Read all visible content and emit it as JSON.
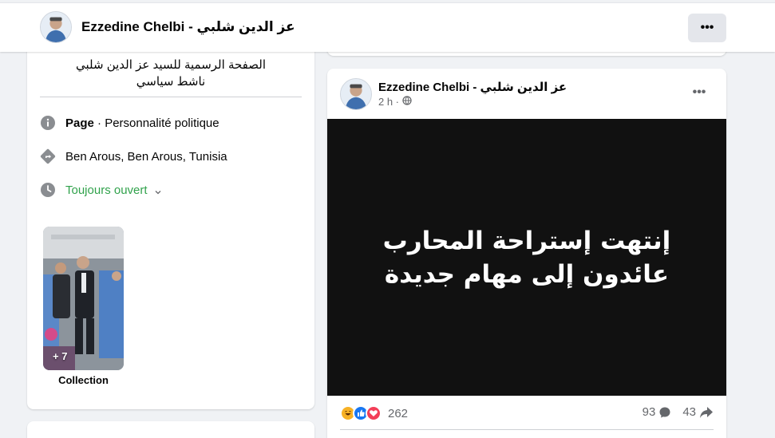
{
  "header": {
    "page_name": "Ezzedine Chelbi - عز الدين شلبي",
    "more_label": "•••"
  },
  "intro": {
    "bio_line1": "الصفحة الرسمية للسيد عز الدين شلبي",
    "bio_line2": "ناشط سياسي",
    "category_bold": "Page",
    "category_rest": " · Personnalité politique",
    "location": "Ben Arous, Ben Arous, Tunisia",
    "hours": "Toujours ouvert",
    "hours_color": "#31a24c"
  },
  "photos": {
    "more_count": "+ 7",
    "caption": "Collection"
  },
  "post": {
    "author": "Ezzedine Chelbi - عز الدين شلبي",
    "time": "2 h ·",
    "more_label": "•••",
    "message": "إنتهت إستراحة المحارب عائدون إلى مهام جديدة",
    "reactions_count": "262",
    "comments_count": "93",
    "shares_count": "43",
    "reaction_types": [
      "haha-icon",
      "like-icon",
      "love-icon"
    ]
  },
  "colors": {
    "accent": "#1877f2",
    "love": "#f33e58",
    "haha": "#f7b125"
  }
}
